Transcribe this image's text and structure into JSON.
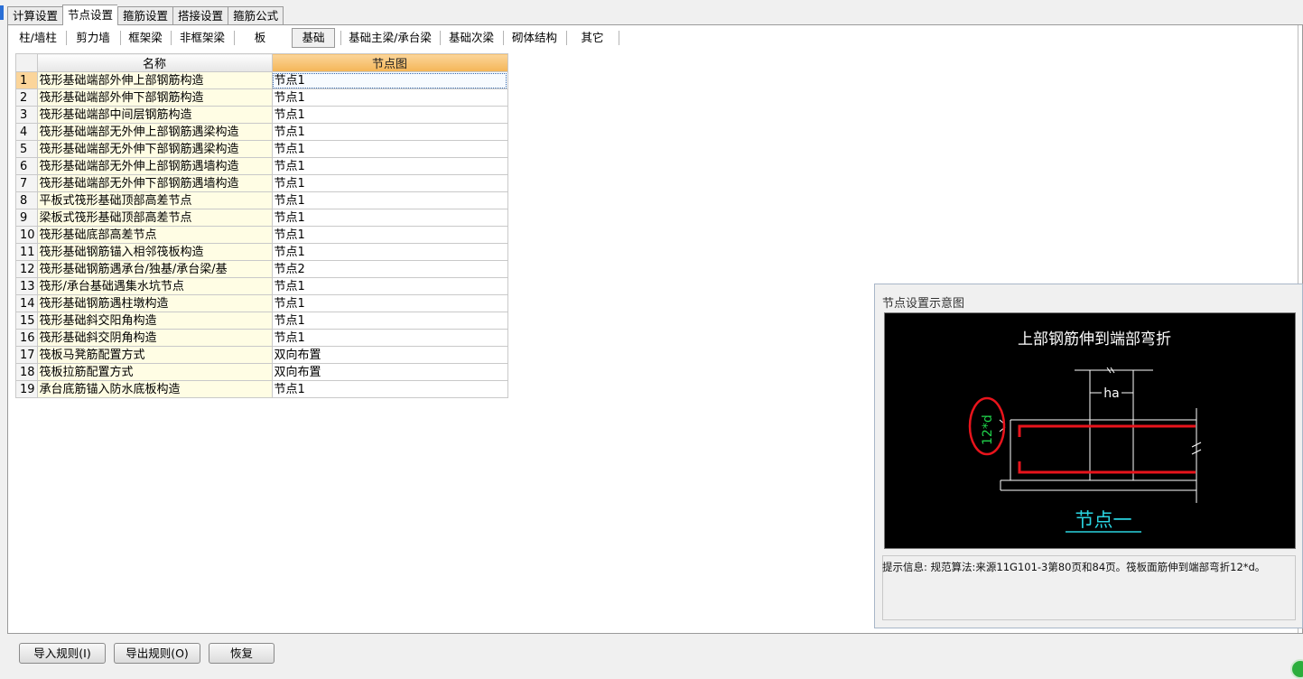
{
  "tabs": [
    "计算设置",
    "节点设置",
    "箍筋设置",
    "搭接设置",
    "箍筋公式"
  ],
  "active_tab": 1,
  "subtabs": [
    "柱/墙柱",
    "剪力墙",
    "框架梁",
    "非框架梁",
    "板",
    "基础",
    "基础主梁/承台梁",
    "基础次梁",
    "砌体结构",
    "其它"
  ],
  "active_subtab": 5,
  "table": {
    "headers": {
      "name": "名称",
      "node": "节点图"
    },
    "rows": [
      {
        "n": "1",
        "name": "筏形基础端部外伸上部钢筋构造",
        "node": "节点1"
      },
      {
        "n": "2",
        "name": "筏形基础端部外伸下部钢筋构造",
        "node": "节点1"
      },
      {
        "n": "3",
        "name": "筏形基础端部中间层钢筋构造",
        "node": "节点1"
      },
      {
        "n": "4",
        "name": "筏形基础端部无外伸上部钢筋遇梁构造",
        "node": "节点1"
      },
      {
        "n": "5",
        "name": "筏形基础端部无外伸下部钢筋遇梁构造",
        "node": "节点1"
      },
      {
        "n": "6",
        "name": "筏形基础端部无外伸上部钢筋遇墙构造",
        "node": "节点1"
      },
      {
        "n": "7",
        "name": "筏形基础端部无外伸下部钢筋遇墙构造",
        "node": "节点1"
      },
      {
        "n": "8",
        "name": "平板式筏形基础顶部高差节点",
        "node": "节点1"
      },
      {
        "n": "9",
        "name": "梁板式筏形基础顶部高差节点",
        "node": "节点1"
      },
      {
        "n": "10",
        "name": "筏形基础底部高差节点",
        "node": "节点1"
      },
      {
        "n": "11",
        "name": "筏形基础钢筋锚入相邻筏板构造",
        "node": "节点1"
      },
      {
        "n": "12",
        "name": "筏形基础钢筋遇承台/独基/承台梁/基",
        "node": "节点2"
      },
      {
        "n": "13",
        "name": "筏形/承台基础遇集水坑节点",
        "node": "节点1"
      },
      {
        "n": "14",
        "name": "筏形基础钢筋遇柱墩构造",
        "node": "节点1"
      },
      {
        "n": "15",
        "name": "筏形基础斜交阳角构造",
        "node": "节点1"
      },
      {
        "n": "16",
        "name": "筏形基础斜交阴角构造",
        "node": "节点1"
      },
      {
        "n": "17",
        "name": "筏板马凳筋配置方式",
        "node": "双向布置"
      },
      {
        "n": "18",
        "name": "筏板拉筋配置方式",
        "node": "双向布置"
      },
      {
        "n": "19",
        "name": "承台底筋锚入防水底板构造",
        "node": "节点1"
      }
    ]
  },
  "preview": {
    "title": "节点设置示意图",
    "diagram_title": "上部钢筋伸到端部弯折",
    "label_ha": "ha",
    "label_12d": "12*d",
    "node_caption": "节点一",
    "hint": "提示信息:  规范算法:来源11G101-3第80页和84页。筏板面筋伸到端部弯折12*d。"
  },
  "buttons": {
    "import": "导入规则(I)",
    "export": "导出规则(O)",
    "restore": "恢复"
  },
  "colors": {
    "selected_header": "#f4b556",
    "name_cell_bg": "#fffde4",
    "rebar_red": "#e8141c",
    "caption_cyan": "#2ad4e0",
    "label_green": "#1fd24a"
  }
}
